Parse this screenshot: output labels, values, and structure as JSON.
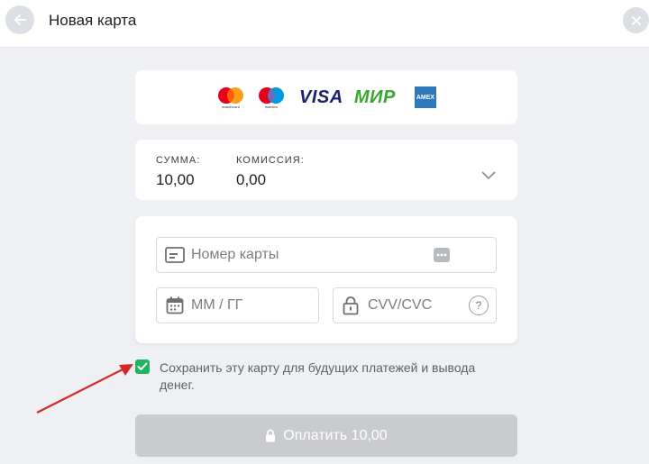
{
  "header": {
    "title": "Новая карта"
  },
  "brands": {
    "mastercard_text": "mastercard",
    "maestro_text": "maestro",
    "visa_text": "VISA",
    "mir_text": "МИР",
    "amex_text": "AMEX"
  },
  "amount": {
    "sum_label": "СУММА:",
    "sum_value": "10,00",
    "fee_label": "КОМИССИЯ:",
    "fee_value": "0,00"
  },
  "form": {
    "card_number_placeholder": "Номер карты",
    "expiry_placeholder": "ММ / ГГ",
    "cvv_placeholder": "CVV/CVC",
    "cvv_help": "?"
  },
  "save": {
    "checked": true,
    "label": "Сохранить эту карту для будущих платежей и вывода денег."
  },
  "pay": {
    "label": "Оплатить 10,00"
  },
  "colors": {
    "accent_green": "#21b35e",
    "arrow_red": "#d62727",
    "button_disabled": "#c9cbce"
  }
}
